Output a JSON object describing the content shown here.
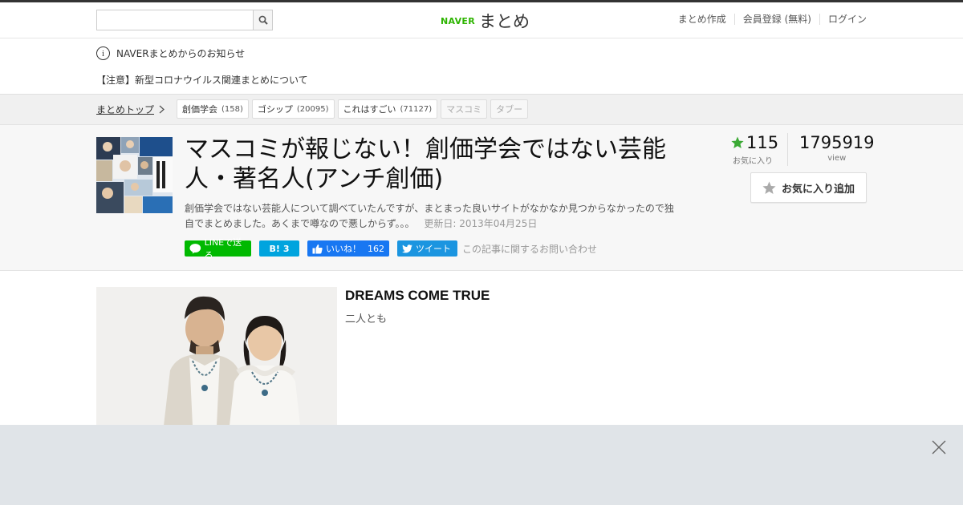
{
  "header": {
    "search": {
      "placeholder": "",
      "value": ""
    },
    "logo": {
      "brand": "NAVER",
      "service": "まとめ"
    },
    "nav": [
      "まとめ作成",
      "会員登録 (無料)",
      "ログイン"
    ]
  },
  "notice": {
    "heading": "NAVERまとめからのお知らせ",
    "item": "【注意】新型コロナウイルス関連まとめについて"
  },
  "breadcrumb": {
    "top_label": "まとめトップ",
    "tags": [
      {
        "name": "創価学会",
        "count": "(158)"
      },
      {
        "name": "ゴシップ",
        "count": "(20095)"
      },
      {
        "name": "これはすごい",
        "count": "(71127)"
      },
      {
        "name": "マスコミ",
        "count": ""
      },
      {
        "name": "タブー",
        "count": ""
      }
    ]
  },
  "article": {
    "title": "マスコミが報じない！創価学会ではない芸能人・著名人(アンチ創価)",
    "description": "創価学会ではない芸能人について調べていたんですが、まとまった良いサイトがなかなか見つからなかったので独自でまとめました。あくまで噂なので悪しからず。。。",
    "updated": "更新日: 2013年04月25日",
    "favorites": "115",
    "favorites_label": "お気に入り",
    "views": "1795919",
    "views_label": "view",
    "fav_button": "お気に入り追加",
    "share": {
      "line": "LINEで送る",
      "hatena_mark": "B!",
      "hatena_count": "3",
      "fb_label": "いいね！",
      "fb_count": "162",
      "tweet": "ツイート"
    },
    "contact": "この記事に関するお問い合わせ"
  },
  "item": {
    "title": "DREAMS COME TRUE",
    "text": "二人とも"
  },
  "colors": {
    "naver_green": "#2db400",
    "line_green": "#00b900",
    "hatena_blue": "#00a4de",
    "fb_blue": "#1877f2",
    "twitter_blue": "#1b95e0",
    "star_green": "#3ba935"
  }
}
